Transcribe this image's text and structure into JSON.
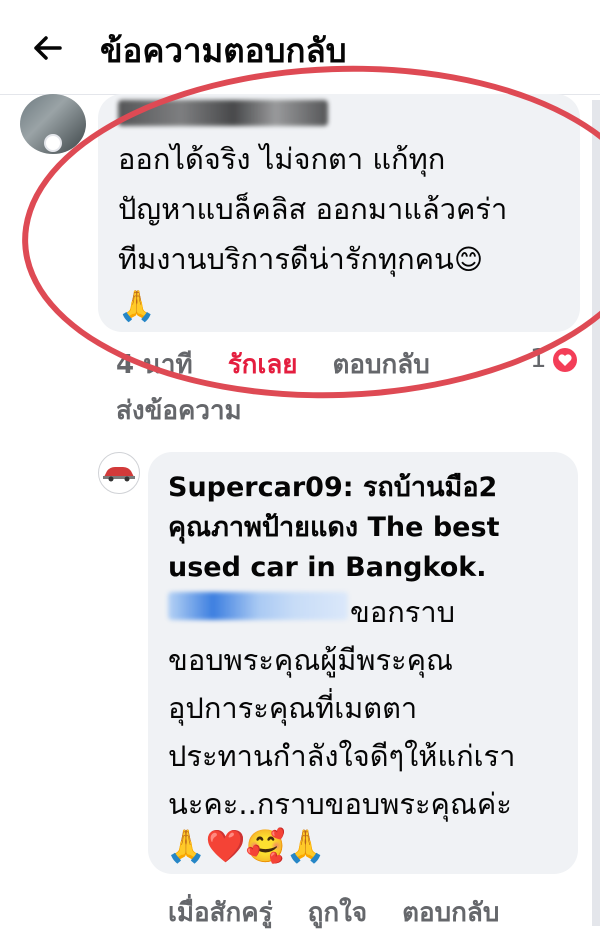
{
  "header": {
    "title": "ข้อความตอบกลับ"
  },
  "comment": {
    "lines": [
      "ออกได้จริง ไม่จกตา แก้ทุก",
      "ปัญหาแบล็คลิส ออกมาแล้วคร่า",
      "ทีมงานบริการดีน่ารักทุกคน"
    ],
    "line_emoji": "😊",
    "trailing_emoji": "🙏",
    "time": "4 นาที",
    "love_label": "รักเลย",
    "reply_label": "ตอบกลับ",
    "reaction_count": "1",
    "send_message_label": "ส่งข้อความ"
  },
  "reply": {
    "author": "Supercar09: รถบ้านมือ2 คุณภาพป้ายแดง The best used car in Bangkok.",
    "first_line_text": "ขอกราบ",
    "lines": [
      "ขอบพระคุณผู้มีพระคุณ",
      "อุปการะคุณที่เมตตา",
      "ประทานกำลังใจดีๆให้แก่เรา",
      "นะคะ..กราบขอบพระคุณค่ะ"
    ],
    "emojis": "🙏❤️🥰🙏",
    "time": "เมื่อสักครู่",
    "like_label": "ถูกใจ",
    "reply_label": "ตอบกลับ"
  },
  "colors": {
    "accent_love": "#e41e3f",
    "annotation_circle": "#de4a54",
    "bubble_bg": "#f0f2f5",
    "meta_text": "#65676b"
  },
  "icons": [
    "back-arrow-icon",
    "heart-icon",
    "car-logo-icon"
  ]
}
